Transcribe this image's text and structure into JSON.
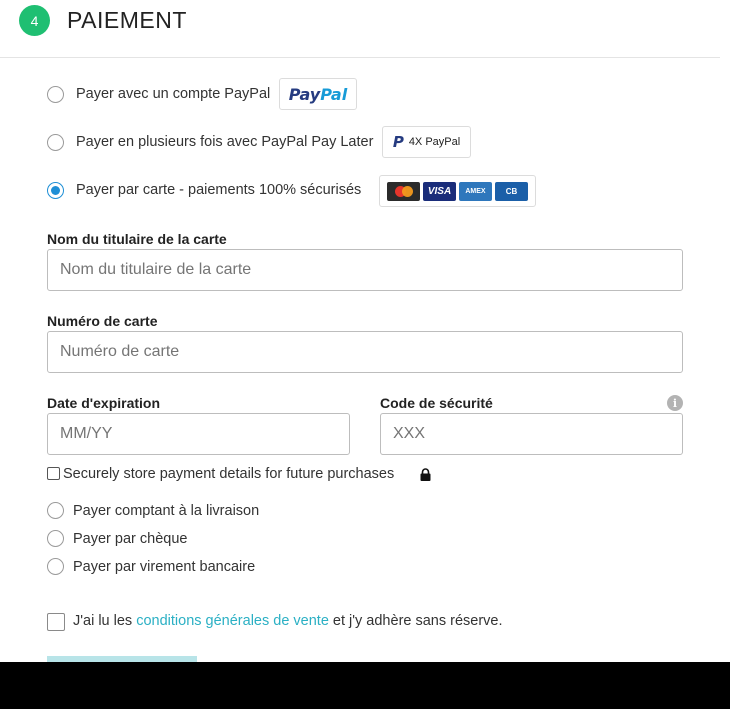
{
  "header": {
    "step_number": "4",
    "title": "PAIEMENT"
  },
  "payment_options": [
    {
      "label": "Payer avec un compte PayPal",
      "selected": false
    },
    {
      "label": "Payer en plusieurs fois avec PayPal Pay Later",
      "selected": false
    },
    {
      "label": "Payer par carte - paiements 100% sécurisés",
      "selected": true
    }
  ],
  "badges": {
    "paypal_dark": "Pay",
    "paypal_light": "Pal",
    "pay4x_text": "4X PayPal",
    "pay4x_logo": "P",
    "cards": {
      "mastercard": "mastercard",
      "visa": "VISA",
      "amex": "AMEX",
      "cb": "CB"
    }
  },
  "card_form": {
    "holder": {
      "label": "Nom du titulaire de la carte",
      "placeholder": "Nom du titulaire de la carte",
      "value": ""
    },
    "number": {
      "label": "Numéro de carte",
      "placeholder": "Numéro de carte",
      "value": ""
    },
    "expiry": {
      "label": "Date d'expiration",
      "placeholder": "MM/YY",
      "value": ""
    },
    "cvc": {
      "label": "Code de sécurité",
      "placeholder": "XXX",
      "value": ""
    },
    "info_icon": "i",
    "store_label": "Securely store payment details for future purchases",
    "store_checked": false
  },
  "other_options": [
    {
      "label": "Payer comptant à la livraison"
    },
    {
      "label": "Payer par chèque"
    },
    {
      "label": "Payer par virement bancaire"
    }
  ],
  "terms": {
    "prefix": "J'ai lu les ",
    "link": "conditions générales de vente",
    "suffix": " et j'y adhère sans réserve.",
    "checked": false
  },
  "colors": {
    "accent_green": "#1fbf72",
    "radio_blue": "#1e8fd6",
    "link_teal": "#2bb0c4",
    "submit_bg": "#b8e4e8"
  },
  "icons": [
    "info-icon",
    "lock-icon",
    "paypal-logo",
    "mastercard-logo",
    "visa-logo",
    "amex-logo",
    "cb-logo"
  ]
}
